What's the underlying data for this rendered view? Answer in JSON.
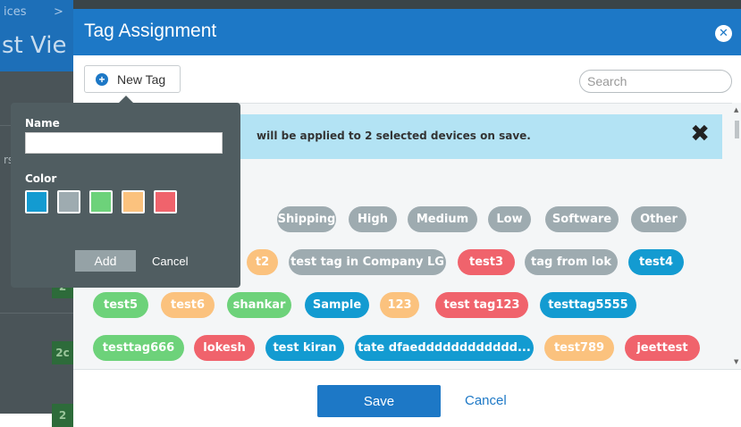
{
  "background": {
    "breadcrumb": "ices",
    "breadcrumb_arrow": ">",
    "title": "st Vie",
    "subtext": "rs",
    "badges": [
      "2",
      "2c",
      "2"
    ]
  },
  "modal": {
    "title": "Tag Assignment",
    "close_glyph": "✕",
    "new_tag_label": "New Tag",
    "new_tag_glyph": "+",
    "search_placeholder": "Search",
    "info_text": "will be applied to 2 selected devices on save.",
    "info_close_glyph": "✖",
    "save_label": "Save",
    "cancel_label": "Cancel",
    "scroll_up_glyph": "▲",
    "scroll_down_glyph": "▼"
  },
  "tags": [
    {
      "label": "Shipping",
      "color": "gray"
    },
    {
      "label": "High",
      "color": "gray"
    },
    {
      "label": "Medium",
      "color": "gray"
    },
    {
      "label": "Low",
      "color": "gray"
    },
    {
      "label": "Software",
      "color": "gray"
    },
    {
      "label": "Other",
      "color": "gray"
    },
    {
      "label": "t2",
      "color": "orange"
    },
    {
      "label": "test tag in Company LG",
      "color": "gray"
    },
    {
      "label": "test3",
      "color": "red"
    },
    {
      "label": "tag from lok",
      "color": "gray"
    },
    {
      "label": "test4",
      "color": "blue"
    },
    {
      "label": "test5",
      "color": "green"
    },
    {
      "label": "test6",
      "color": "orange"
    },
    {
      "label": "shankar",
      "color": "green"
    },
    {
      "label": "Sample",
      "color": "blue"
    },
    {
      "label": "123",
      "color": "orange"
    },
    {
      "label": "test tag123",
      "color": "red"
    },
    {
      "label": "testtag5555",
      "color": "blue"
    },
    {
      "label": "testtag666",
      "color": "green"
    },
    {
      "label": "lokesh",
      "color": "red"
    },
    {
      "label": "test kiran",
      "color": "blue"
    },
    {
      "label": "tate dfaedddddddddddd...",
      "color": "blue"
    },
    {
      "label": "test789",
      "color": "orange"
    },
    {
      "label": "jeettest",
      "color": "red"
    }
  ],
  "popover": {
    "name_label": "Name",
    "name_value": "",
    "color_label": "Color",
    "colors": [
      "#139bd1",
      "#9eabb0",
      "#6dd27a",
      "#fbc27e",
      "#f0636c"
    ],
    "add_label": "Add",
    "cancel_label": "Cancel"
  },
  "colors": {
    "header": "#1d78c6",
    "info_bar": "#b3e3f4",
    "popover": "#505d61"
  }
}
